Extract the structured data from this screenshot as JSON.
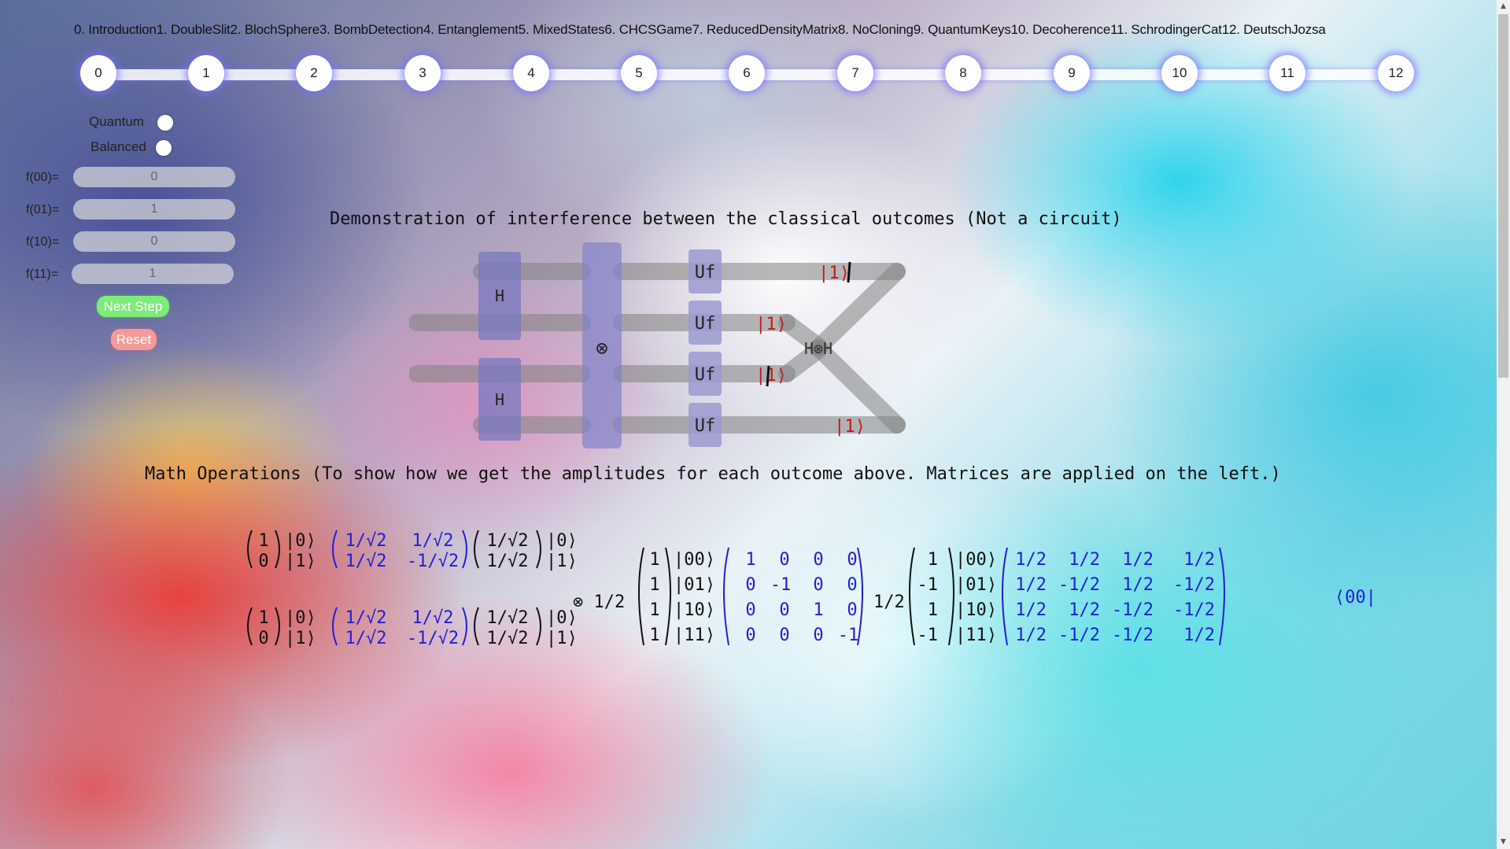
{
  "chapters": [
    "0. Introduction",
    "1. DoubleSlit",
    "2. BlochSphere",
    "3. BombDetection",
    "4. Entanglement",
    "5. MixedStates",
    "6. CHCSGame",
    "7. ReducedDensityMatrix",
    "8. NoCloning",
    "9. QuantumKeys",
    "10. Decoherence",
    "11. SchrodingerCat",
    "12. DeutschJozsa"
  ],
  "steps": [
    "0",
    "1",
    "2",
    "3",
    "4",
    "5",
    "6",
    "7",
    "8",
    "9",
    "10",
    "11",
    "12"
  ],
  "controls": {
    "quantum_label": "Quantum",
    "balanced_label": "Balanced",
    "fields": [
      {
        "label": "f(00)=",
        "value": "0"
      },
      {
        "label": "f(01)=",
        "value": "1"
      },
      {
        "label": "f(10)=",
        "value": "0"
      },
      {
        "label": "f(11)=",
        "value": "1"
      }
    ],
    "next_label": "Next Step",
    "reset_label": "Reset"
  },
  "demo_heading": "Demonstration of interference between the classical outcomes (Not a circuit)",
  "math_heading": "Math Operations (To show how we get the amplitudes for each outcome above. Matrices are applied on the left.)",
  "circuit": {
    "h_label": "H",
    "tensor_symbol": "⊗",
    "uf_label": "Uf",
    "hh_label": "H⊗H",
    "outputs": [
      "|1⟩",
      "|1⟩",
      "|1⟩",
      "|1⟩"
    ]
  },
  "math": {
    "vec_top": [
      "1",
      "0"
    ],
    "kets_1q": [
      "|0⟩",
      "|1⟩"
    ],
    "hadamard": [
      [
        "1/√2",
        "1/√2"
      ],
      [
        "1/√2",
        "-1/√2"
      ]
    ],
    "plus_state": [
      "1/√2",
      "1/√2"
    ],
    "tensor_half": "⊗ 1/2",
    "state4": [
      "1",
      "1",
      "1",
      "1"
    ],
    "kets_2q": [
      "|00⟩",
      "|01⟩",
      "|10⟩",
      "|11⟩"
    ],
    "oracle": [
      [
        "1",
        "0",
        "0",
        "0"
      ],
      [
        "0",
        "-1",
        "0",
        "0"
      ],
      [
        "0",
        "0",
        "1",
        "0"
      ],
      [
        "0",
        "0",
        "0",
        "-1"
      ]
    ],
    "half": "1/2",
    "state4_after": [
      "1",
      "-1",
      "1",
      "-1"
    ],
    "hh": [
      [
        "1/2",
        "1/2",
        "1/2",
        "1/2"
      ],
      [
        "1/2",
        "-1/2",
        "1/2",
        "-1/2"
      ],
      [
        "1/2",
        "1/2",
        "-1/2",
        "-1/2"
      ],
      [
        "1/2",
        "-1/2",
        "-1/2",
        "1/2"
      ]
    ],
    "bra": "⟨00|"
  },
  "colors": {
    "blue_text": "#2020d8",
    "red_text": "#c01818",
    "gate": "#9b9ad0"
  }
}
